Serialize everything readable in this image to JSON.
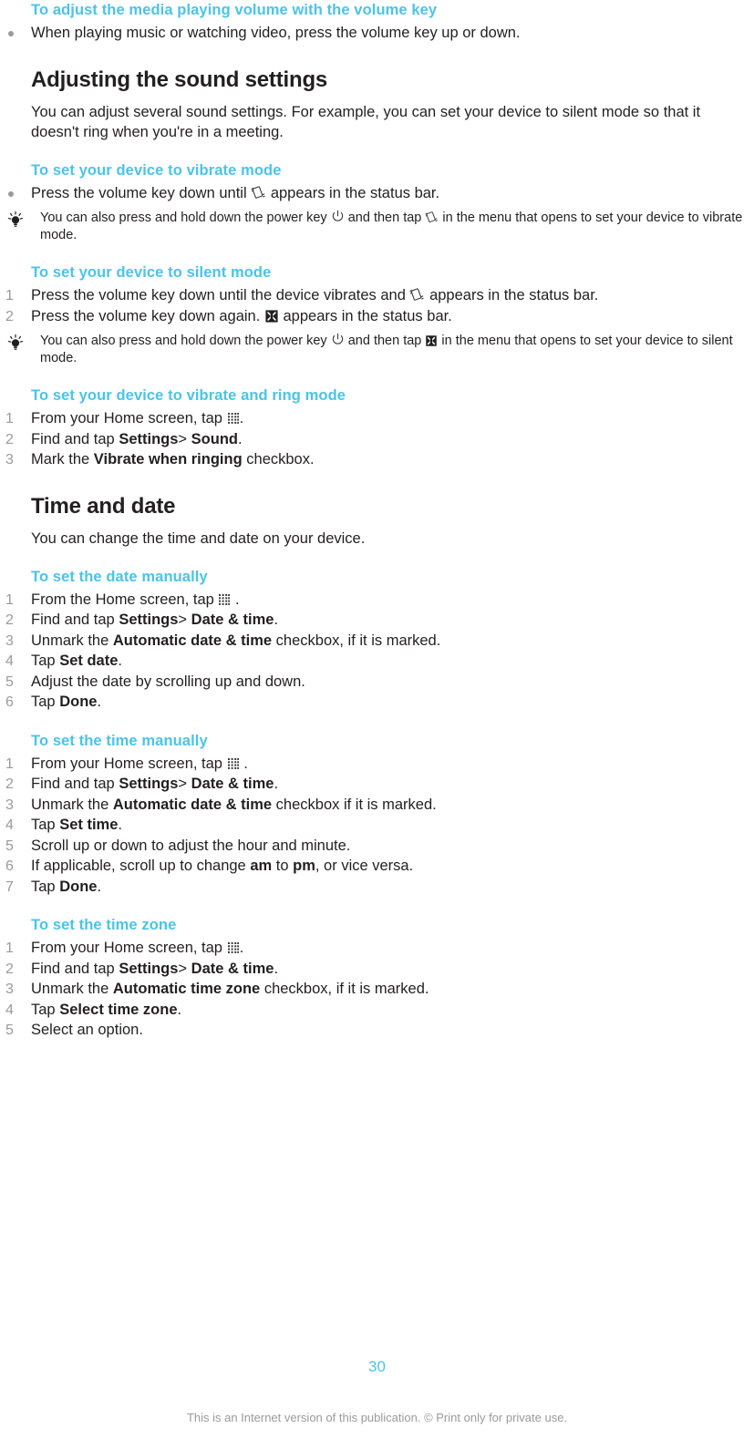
{
  "page": {
    "number": "30",
    "footer_note": "This is an Internet version of this publication. © Print only for private use.",
    "accent_color": "#4bc3e8",
    "text_color": "#231f20",
    "muted_color": "#9a9a9a"
  },
  "sections": {
    "media_volume": {
      "heading": "To adjust the media playing volume with the volume key",
      "bullet_1": "When playing music or watching video, press the volume key up or down."
    },
    "adjusting_sound": {
      "heading": "Adjusting the sound settings",
      "intro": "You can adjust several sound settings. For example, you can set your device to silent mode so that it doesn't ring when you're in a meeting."
    },
    "vibrate_mode": {
      "heading": "To set your device to vibrate mode",
      "bullet_1_before": "Press the volume key down until",
      "bullet_1_after": "appears in the status bar.",
      "tip_part_1": "You can also press and hold down the power key",
      "tip_part_2": "and then tap",
      "tip_part_3": "in the menu that opens to set your device to vibrate mode."
    },
    "silent_mode": {
      "heading": "To set your device to silent mode",
      "step_1_before": "Press the volume key down until the device vibrates and",
      "step_1_after": "appears in the status bar.",
      "step_2_before": "Press the volume key down again.",
      "step_2_after": "appears in the status bar.",
      "tip_part_1": "You can also press and hold down the power key",
      "tip_part_2": "and then tap",
      "tip_part_3": "in the menu that opens to set your device to silent mode."
    },
    "vibrate_and_ring": {
      "heading": "To set your device to vibrate and ring mode",
      "step_1_before": "From your Home screen, tap",
      "step_1_after": ".",
      "step_2_pre": "Find and tap",
      "step_2_bold_1": "Settings",
      "step_2_sep": ">",
      "step_2_bold_2": "Sound",
      "step_2_post": ".",
      "step_3_pre": "Mark the",
      "step_3_bold": "Vibrate when ringing",
      "step_3_post": "checkbox."
    },
    "time_and_date": {
      "heading": "Time and date",
      "intro": "You can change the time and date on your device."
    },
    "date_manually": {
      "heading": "To set the date manually",
      "step_1_before": "From the Home screen, tap",
      "step_1_after": ".",
      "step_2_pre": "Find and tap",
      "step_2_bold_1": "Settings",
      "step_2_sep": ">",
      "step_2_bold_2": "Date & time",
      "step_2_post": ".",
      "step_3_pre": "Unmark the",
      "step_3_bold": "Automatic date & time",
      "step_3_post": "checkbox, if it is marked.",
      "step_4_pre": "Tap",
      "step_4_bold": "Set date",
      "step_4_post": ".",
      "step_5": "Adjust the date by scrolling up and down.",
      "step_6_pre": "Tap",
      "step_6_bold": "Done",
      "step_6_post": "."
    },
    "time_manually": {
      "heading": "To set the time manually",
      "step_1_before": "From your Home screen, tap",
      "step_1_after": ".",
      "step_2_pre": "Find and tap",
      "step_2_bold_1": "Settings",
      "step_2_sep": ">",
      "step_2_bold_2": "Date & time",
      "step_2_post": ".",
      "step_3_pre": "Unmark the",
      "step_3_bold": "Automatic date & time",
      "step_3_post": "checkbox if it is marked.",
      "step_4_pre": "Tap",
      "step_4_bold": "Set time",
      "step_4_post": ".",
      "step_5": "Scroll up or down to adjust the hour and minute.",
      "step_6_pre": "If applicable, scroll up to change",
      "step_6_bold_1": "am",
      "step_6_mid": "to",
      "step_6_bold_2": "pm",
      "step_6_post": ", or vice versa.",
      "step_7_pre": "Tap",
      "step_7_bold": "Done",
      "step_7_post": "."
    },
    "time_zone": {
      "heading": "To set the time zone",
      "step_1_before": "From your Home screen, tap",
      "step_1_after": ".",
      "step_2_pre": "Find and tap",
      "step_2_bold_1": "Settings",
      "step_2_sep": ">",
      "step_2_bold_2": "Date & time",
      "step_2_post": ".",
      "step_3_pre": "Unmark the",
      "step_3_bold": "Automatic time zone",
      "step_3_post": "checkbox, if it is marked.",
      "step_4_pre": "Tap",
      "step_4_bold": "Select time zone",
      "step_4_post": ".",
      "step_5": "Select an option."
    }
  },
  "list_numbers": {
    "n1": "1",
    "n2": "2",
    "n3": "3",
    "n4": "4",
    "n5": "5",
    "n6": "6",
    "n7": "7"
  },
  "icons": {
    "vibrate": "vibrate-icon",
    "silent": "silent-mode-icon",
    "power": "power-key-icon",
    "apps": "app-grid-icon",
    "tip": "lightbulb-tip-icon"
  }
}
